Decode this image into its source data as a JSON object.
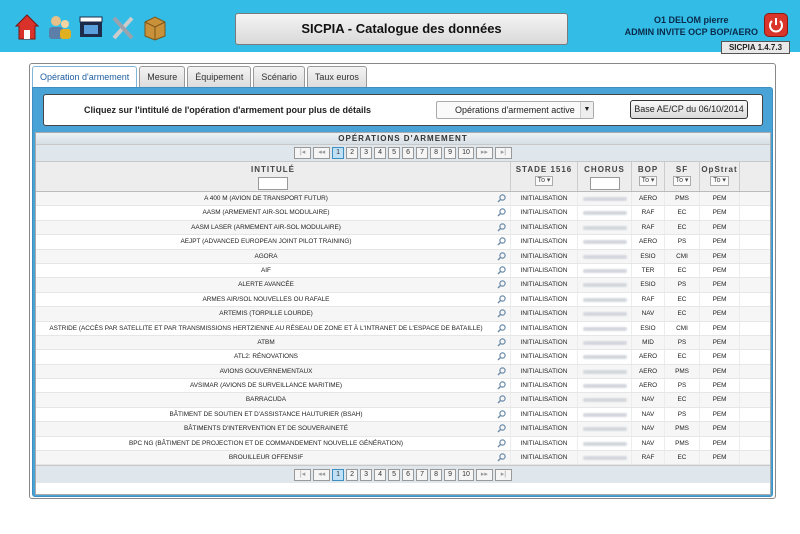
{
  "header": {
    "title": "SICPIA - Catalogue des données",
    "user_name": "O1 DELOM pierre",
    "user_role": "ADMIN INVITE OCP BOP/AERO",
    "version": "SICPIA 1.4.7.3",
    "icons": [
      "home-icon",
      "users-icon",
      "film-icon",
      "tools-icon",
      "package-icon"
    ]
  },
  "tabs": [
    {
      "label": "Opération d'armement",
      "active": true
    },
    {
      "label": "Mesure"
    },
    {
      "label": "Équipement"
    },
    {
      "label": "Scénario"
    },
    {
      "label": "Taux euros"
    }
  ],
  "filter": {
    "instruction": "Cliquez sur l'intitulé de l'opération d'armement pour plus de détails",
    "select_value": "Opérations d'armement active",
    "button": "Base AE/CP du 06/10/2014"
  },
  "table": {
    "caption": "OPÉRATIONS D'ARMEMENT",
    "pager": {
      "first": "|◂",
      "prev": "◂◂",
      "pages": [
        "1",
        "2",
        "3",
        "4",
        "5",
        "6",
        "7",
        "8",
        "9",
        "10"
      ],
      "current": "1",
      "next": "▸▸",
      "last": "▸|"
    },
    "columns": {
      "intitule": "INTITULÉ",
      "stade": "STADE 1516",
      "chorus": "CHORUS",
      "bop": "BOP",
      "sf": "SF",
      "opstrat": "OpStrat",
      "filter_all": "To"
    },
    "rows": [
      {
        "intitule": "A 400 M (AVION DE TRANSPORT FUTUR)",
        "stade": "INITIALISATION",
        "bop": "AERO",
        "sf": "PMS",
        "opstrat": "PEM"
      },
      {
        "intitule": "AASM (ARMEMENT AIR-SOL MODULAIRE)",
        "stade": "INITIALISATION",
        "bop": "RAF",
        "sf": "EC",
        "opstrat": "PEM"
      },
      {
        "intitule": "AASM LASER (ARMEMENT AIR-SOL MODULAIRE)",
        "stade": "INITIALISATION",
        "bop": "RAF",
        "sf": "EC",
        "opstrat": "PEM"
      },
      {
        "intitule": "AEJPT (ADVANCED EUROPEAN JOINT PILOT TRAINING)",
        "stade": "INITIALISATION",
        "bop": "AERO",
        "sf": "PS",
        "opstrat": "PEM"
      },
      {
        "intitule": "AGORA",
        "stade": "INITIALISATION",
        "bop": "ESIO",
        "sf": "CMI",
        "opstrat": "PEM"
      },
      {
        "intitule": "AIF",
        "stade": "INITIALISATION",
        "bop": "TER",
        "sf": "EC",
        "opstrat": "PEM"
      },
      {
        "intitule": "ALERTE AVANCÉE",
        "stade": "INITIALISATION",
        "bop": "ESIO",
        "sf": "PS",
        "opstrat": "PEM"
      },
      {
        "intitule": "ARMES AIR/SOL NOUVELLES OU RAFALE",
        "stade": "INITIALISATION",
        "bop": "RAF",
        "sf": "EC",
        "opstrat": "PEM"
      },
      {
        "intitule": "ARTEMIS (TORPILLE LOURDE)",
        "stade": "INITIALISATION",
        "bop": "NAV",
        "sf": "EC",
        "opstrat": "PEM"
      },
      {
        "intitule": "ASTRIDE (ACCÈS PAR SATELLITE ET PAR TRANSMISSIONS HERTZIENNE AU RÉSEAU DE ZONE ET À L'INTRANET DE L'ESPACE DE BATAILLE)",
        "stade": "INITIALISATION",
        "bop": "ESIO",
        "sf": "CMI",
        "opstrat": "PEM"
      },
      {
        "intitule": "ATBM",
        "stade": "INITIALISATION",
        "bop": "MID",
        "sf": "PS",
        "opstrat": "PEM"
      },
      {
        "intitule": "ATL2: RÉNOVATIONS",
        "stade": "INITIALISATION",
        "bop": "AERO",
        "sf": "EC",
        "opstrat": "PEM"
      },
      {
        "intitule": "AVIONS GOUVERNEMENTAUX",
        "stade": "INITIALISATION",
        "bop": "AERO",
        "sf": "PMS",
        "opstrat": "PEM"
      },
      {
        "intitule": "AVSIMAR (AVIONS DE SURVEILLANCE MARITIME)",
        "stade": "INITIALISATION",
        "bop": "AERO",
        "sf": "PS",
        "opstrat": "PEM"
      },
      {
        "intitule": "BARRACUDA",
        "stade": "INITIALISATION",
        "bop": "NAV",
        "sf": "EC",
        "opstrat": "PEM"
      },
      {
        "intitule": "BÂTIMENT DE SOUTIEN ET D'ASSISTANCE HAUTURIER (BSAH)",
        "stade": "INITIALISATION",
        "bop": "NAV",
        "sf": "PS",
        "opstrat": "PEM"
      },
      {
        "intitule": "BÂTIMENTS D'INTERVENTION ET DE SOUVERAINETÉ",
        "stade": "INITIALISATION",
        "bop": "NAV",
        "sf": "PMS",
        "opstrat": "PEM"
      },
      {
        "intitule": "BPC NG (BÂTIMENT DE PROJECTION ET DE COMMANDEMENT NOUVELLE GÉNÉRATION)",
        "stade": "INITIALISATION",
        "bop": "NAV",
        "sf": "PMS",
        "opstrat": "PEM"
      },
      {
        "intitule": "BROUILLEUR OFFENSIF",
        "stade": "INITIALISATION",
        "bop": "RAF",
        "sf": "EC",
        "opstrat": "PEM"
      }
    ]
  }
}
